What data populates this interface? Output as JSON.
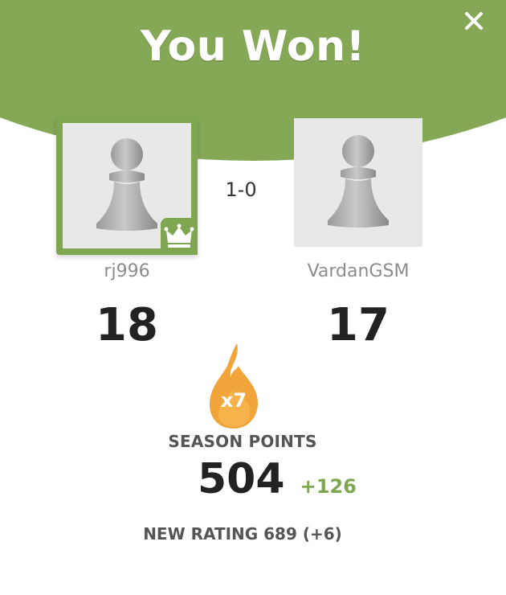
{
  "header": {
    "title": "You Won!",
    "close_icon": "close-icon"
  },
  "game": {
    "result": "1-0"
  },
  "players": [
    {
      "username": "rj996",
      "stat": "18",
      "avatar_icon": "pawn-icon",
      "badge_icon": "crown-icon",
      "winner": true
    },
    {
      "username": "VardanGSM",
      "stat": "17",
      "avatar_icon": "pawn-icon",
      "winner": false
    }
  ],
  "streak": {
    "icon": "flame-icon",
    "label": "x7"
  },
  "season": {
    "label": "SEASON POINTS",
    "points": "504",
    "delta": "+126"
  },
  "rating": {
    "text": "NEW RATING 689 (+6)"
  },
  "colors": {
    "brand_green": "#85a857",
    "accent_green": "#7fa650",
    "flame_orange": "#f0a43a",
    "text_dark": "#222222",
    "text_gray": "#8c8c8c"
  }
}
